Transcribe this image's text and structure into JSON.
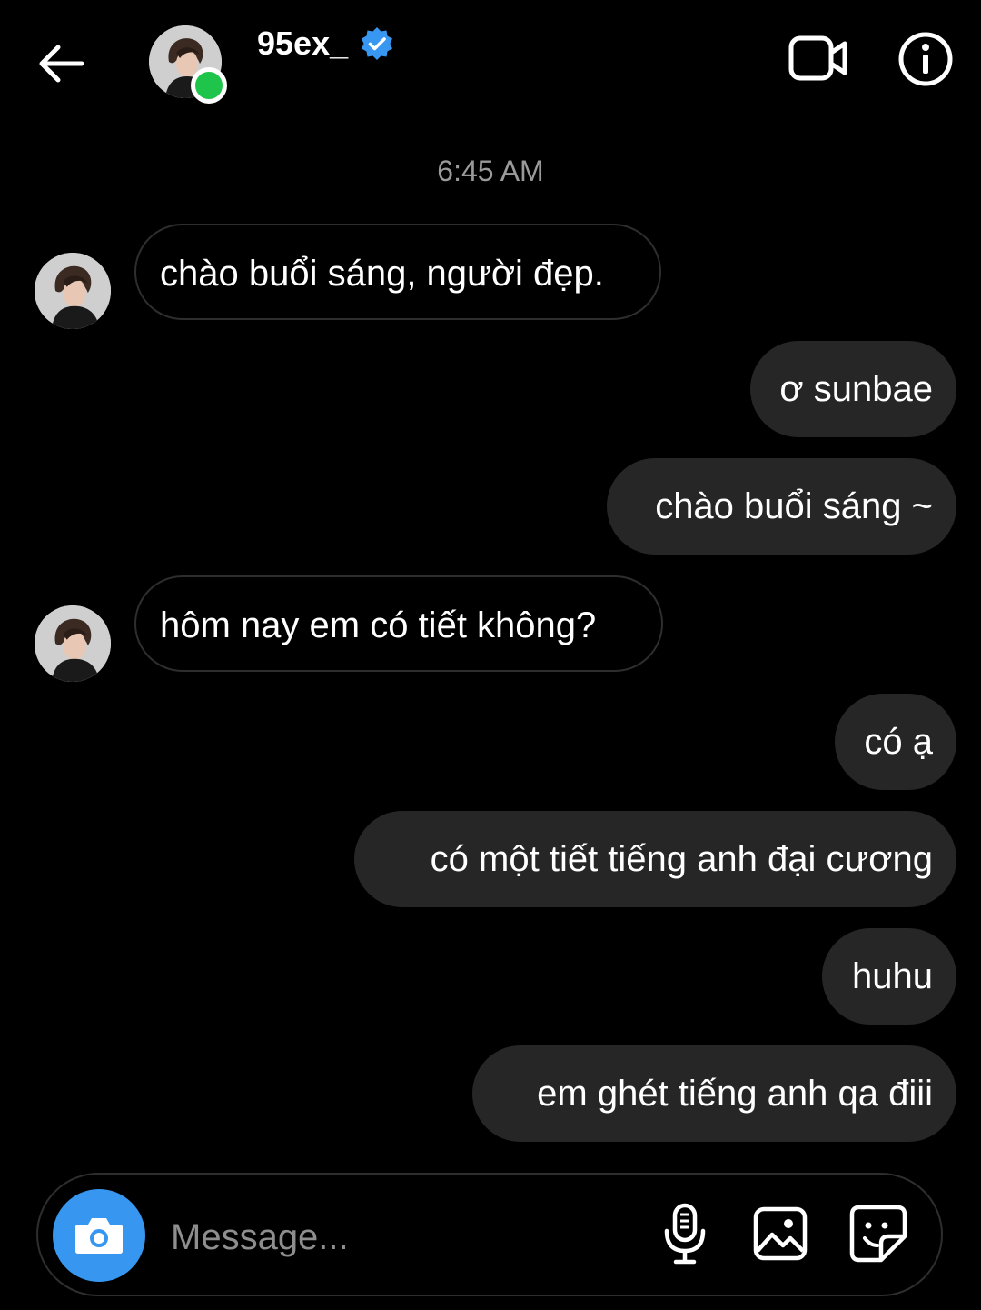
{
  "header": {
    "username": "95ex_",
    "verified": true,
    "online": true,
    "icons": {
      "back": "arrow-left-icon",
      "video": "video-call-icon",
      "info": "info-icon",
      "verified": "verified-badge-icon"
    }
  },
  "conversation": {
    "timestamp": "6:45 AM",
    "messages": [
      {
        "sender": "them",
        "text": "chào buổi sáng, người đẹp."
      },
      {
        "sender": "me",
        "text": "ơ sunbae"
      },
      {
        "sender": "me",
        "text": "chào buổi sáng ~"
      },
      {
        "sender": "them",
        "text": "hôm nay em có tiết không?"
      },
      {
        "sender": "me",
        "text": "có ạ"
      },
      {
        "sender": "me",
        "text": "có một tiết tiếng anh đại cương"
      },
      {
        "sender": "me",
        "text": "huhu"
      },
      {
        "sender": "me",
        "text": "em ghét tiếng anh qa điii"
      }
    ]
  },
  "composer": {
    "placeholder": "Message...",
    "icons": {
      "camera": "camera-icon",
      "mic": "microphone-icon",
      "gallery": "image-gallery-icon",
      "sticker": "sticker-icon"
    }
  },
  "colors": {
    "background": "#000000",
    "outgoing_bubble": "#262626",
    "incoming_border": "#2e2e2e",
    "accent": "#3797f0",
    "online": "#1fc44a",
    "timestamp": "#9a9a9a",
    "placeholder": "#8e8e8e"
  }
}
